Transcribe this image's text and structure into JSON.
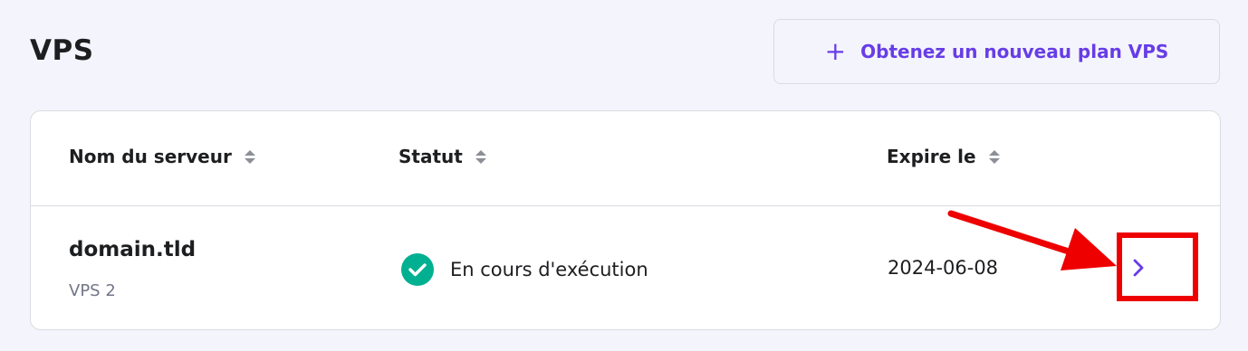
{
  "header": {
    "title": "VPS",
    "new_plan_button": {
      "icon": "plus-icon",
      "plus": "+",
      "label": "Obtenez un nouveau plan VPS"
    }
  },
  "table": {
    "columns": [
      {
        "label": "Nom du serveur",
        "sort_icon": "sort-icon"
      },
      {
        "label": "Statut",
        "sort_icon": "sort-icon"
      },
      {
        "label": "Expire le",
        "sort_icon": "sort-icon"
      }
    ],
    "rows": [
      {
        "name": "domain.tld",
        "plan": "VPS 2",
        "status": "En cours d'exécution",
        "status_icon": "check-circle-icon",
        "expires": "2024-06-08",
        "action_icon": "chevron-right-icon"
      }
    ]
  },
  "annotation": {
    "color": "#ee0000",
    "arrow": "red-arrow",
    "box": "red-highlight-box"
  },
  "colors": {
    "accent": "#673de6",
    "success": "#00b090",
    "background": "#f4f4fc"
  }
}
